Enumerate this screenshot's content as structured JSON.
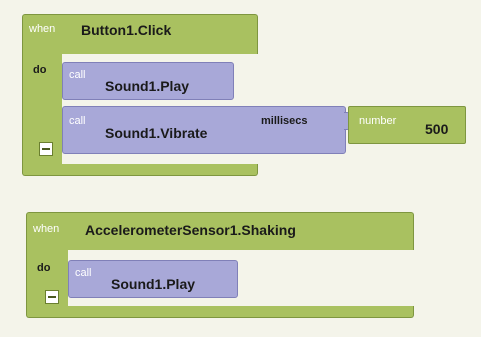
{
  "blocks": {
    "button_event": {
      "when_label": "when",
      "event_name": "Button1.Click",
      "do_label": "do",
      "calls": [
        {
          "call_label": "call",
          "method": "Sound1.Play"
        },
        {
          "call_label": "call",
          "method": "Sound1.Vibrate",
          "param_label": "millisecs",
          "param_value": {
            "type_label": "number",
            "value": "500"
          }
        }
      ]
    },
    "accel_event": {
      "when_label": "when",
      "event_name": "AccelerometerSensor1.Shaking",
      "do_label": "do",
      "calls": [
        {
          "call_label": "call",
          "method": "Sound1.Play"
        }
      ]
    }
  },
  "colors": {
    "event_block": "#a9c160",
    "call_block": "#a8a8d8",
    "workspace": "#f4f4ea"
  }
}
